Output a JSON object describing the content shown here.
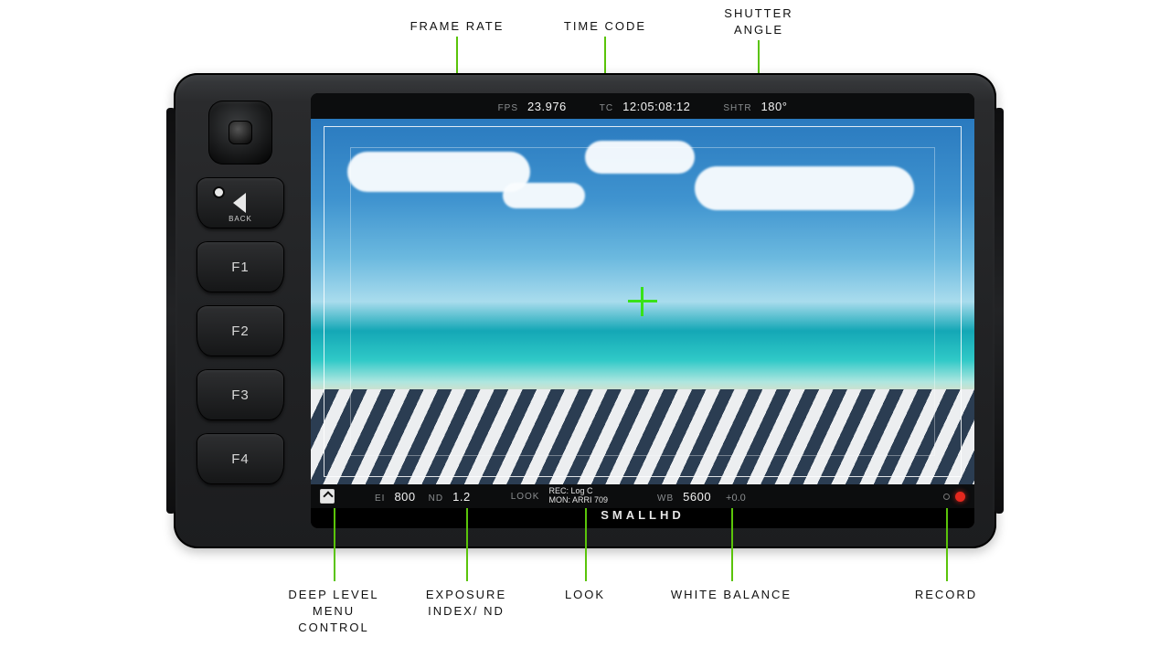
{
  "callouts": {
    "frame_rate": "FRAME RATE",
    "time_code": "TIME CODE",
    "shutter_angle": "SHUTTER\nANGLE",
    "deep_menu": "DEEP LEVEL\nMENU\nCONTROL",
    "exposure": "EXPOSURE\nINDEX/ ND",
    "look": "LOOK",
    "white_balance": "WHITE BALANCE",
    "record": "RECORD"
  },
  "hw_buttons": {
    "back": "BACK",
    "f1": "F1",
    "f2": "F2",
    "f3": "F3",
    "f4": "F4"
  },
  "topbar": {
    "fps_k": "FPS",
    "fps_v": "23.976",
    "tc_k": "TC",
    "tc_v": "12:05:08:12",
    "shtr_k": "SHTR",
    "shtr_v": "180°"
  },
  "botbar": {
    "ei_k": "EI",
    "ei_v": "800",
    "nd_k": "ND",
    "nd_v": "1.2",
    "look_k": "LOOK",
    "look_line1": "REC: Log C",
    "look_line2": "MON: ARRI 709",
    "wb_k": "WB",
    "wb_v": "5600",
    "wb_tint": "+0.0"
  },
  "brand": "SMALLHD"
}
